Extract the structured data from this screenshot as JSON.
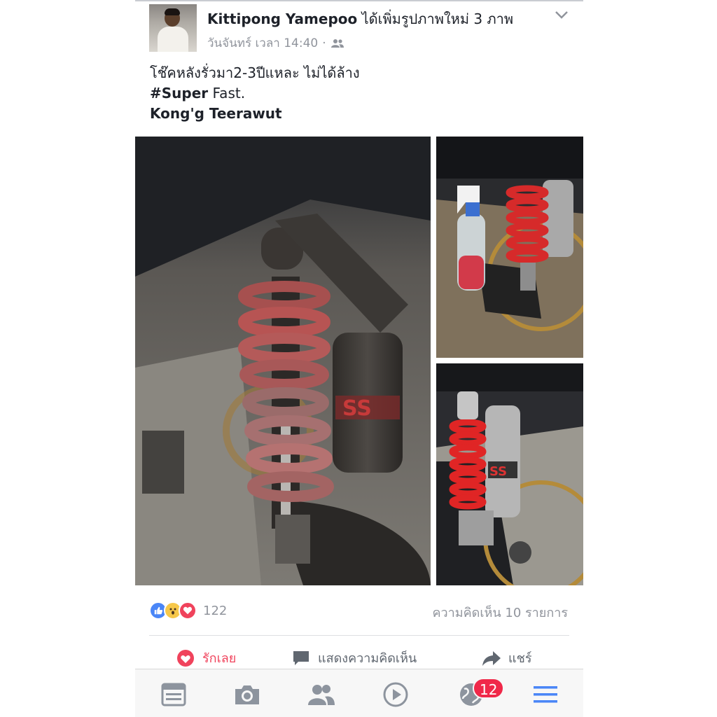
{
  "post": {
    "author_name": "Kittipong Yamepoo",
    "action_text": "ได้เพิ่มรูปภาพใหม่ 3 ภาพ",
    "timestamp": "วันจันทร์ เวลา 14:40",
    "privacy_icon": "friends-icon",
    "text": {
      "line1": "โช๊คหลังรั่วมา2-3ปีแหละ ไม่ได้ล้าง",
      "hashtag": "#Super",
      "line2_rest": " Fast.",
      "tagged": "Kong'g Teerawut"
    },
    "photos": [
      {
        "id": "main",
        "description": "YSS shock"
      },
      {
        "id": "top-right",
        "description": "YSS shock"
      },
      {
        "id": "bottom-right",
        "description": "YSS shock"
      }
    ]
  },
  "engagement": {
    "reaction_icons": [
      "like-icon",
      "wow-icon",
      "love-icon"
    ],
    "reaction_count": "122",
    "comment_count_text": "ความคิดเห็น 10 รายการ"
  },
  "actions": {
    "love": "รักเลย",
    "comment": "แสดงความคิดเห็น",
    "share": "แชร์"
  },
  "tabbar": {
    "items": [
      "news-feed-icon",
      "camera-icon",
      "friends-icon",
      "video-icon",
      "globe-icon",
      "menu-icon"
    ],
    "notification_badge": "12"
  },
  "colors": {
    "accent_blue": "#4a86f7",
    "love_red": "#f0435c",
    "secondary_text": "#90949c",
    "badge_red": "#f02849"
  }
}
